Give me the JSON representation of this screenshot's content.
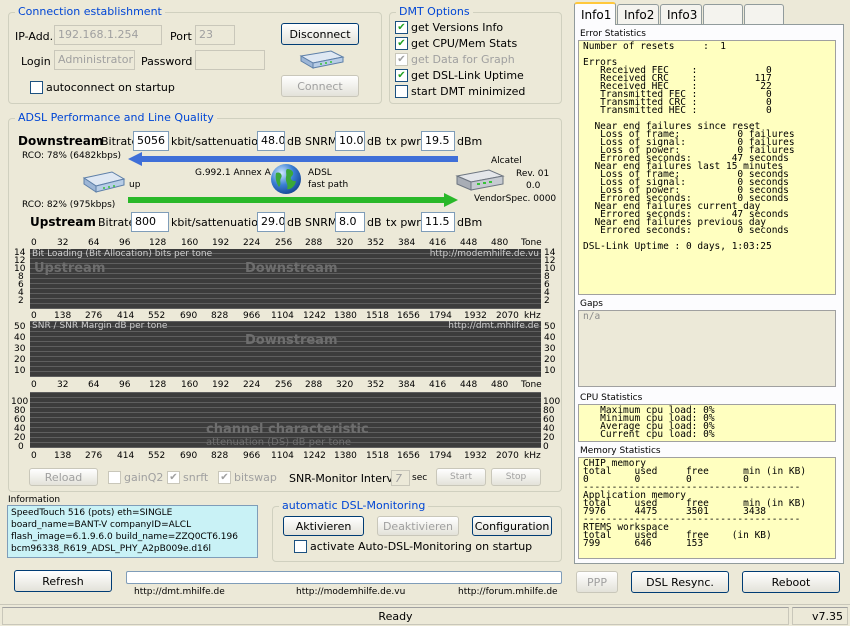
{
  "connection": {
    "title": "Connection establishment",
    "ip_label": "IP-Add.",
    "ip_value": "192.168.1.254",
    "port_label": "Port",
    "port_value": "23",
    "login_label": "Login",
    "login_value": "Administrator",
    "password_label": "Password",
    "password_value": "",
    "autoconnect_label": "autoconnect on startup",
    "disconnect_label": "Disconnect",
    "connect_label": "Connect"
  },
  "dmt_options": {
    "title": "DMT Options",
    "items": [
      {
        "label": "get Versions Info",
        "checked": true,
        "disabled": false
      },
      {
        "label": "get CPU/Mem Stats",
        "checked": true,
        "disabled": false
      },
      {
        "label": "get Data for Graph",
        "checked": true,
        "disabled": true
      },
      {
        "label": "get DSL-Link Uptime",
        "checked": true,
        "disabled": false
      },
      {
        "label": "start DMT minimized",
        "checked": false,
        "disabled": false
      }
    ]
  },
  "adsl": {
    "title": "ADSL Performance and Line Quality",
    "downstream_label": "Downstream",
    "upstream_label": "Upstream",
    "bitrate_label": "Bitrate",
    "kbits": "kbit/s",
    "attn_label": "attenuation",
    "db": "dB",
    "snrm_label": "SNRM",
    "txpwr_label": "tx pwr",
    "dbm": "dBm",
    "down": {
      "bitrate": "5056",
      "attenuation": "48.0",
      "snrm": "10.0",
      "txpwr": "19.5"
    },
    "up": {
      "bitrate": "800",
      "attenuation": "29.0",
      "snrm": "8.0",
      "txpwr": "11.5"
    },
    "rco_down": "RCO: 78% (6482kbps)",
    "rco_up": "RCO: 82% (975kbps)",
    "mode": "G.992.1 Annex A",
    "adsl_label": "ADSL",
    "fastpath": "fast path",
    "up_label": "up",
    "vendor": "Alcatel",
    "rev": "Rev. 01",
    "rev_val": "0.0",
    "vendorspec": "VendorSpec. 0000"
  },
  "graphs": {
    "tone_ticks": [
      "0",
      "32",
      "64",
      "96",
      "128",
      "160",
      "192",
      "224",
      "256",
      "288",
      "320",
      "352",
      "384",
      "416",
      "448",
      "480"
    ],
    "tone_label": "Tone",
    "khz_ticks": [
      "0",
      "138",
      "276",
      "414",
      "552",
      "690",
      "828",
      "966",
      "1104",
      "1242",
      "1380",
      "1518",
      "1656",
      "1794",
      "1932",
      "2070"
    ],
    "khz_label": "kHz",
    "bitload_title": "Bit Loading (Bit Allocation)  bits per tone",
    "bitload_url": "http://modemhilfe.de.vu",
    "bitload_y": [
      "14",
      "12",
      "10",
      "8",
      "6",
      "4",
      "2"
    ],
    "wm_upstream": "Upstream",
    "wm_downstream": "Downstream",
    "snr_title": "SNR / SNR Margin  dB per tone",
    "snr_url": "http://dmt.mhilfe.de",
    "snr_y": [
      "50",
      "40",
      "30",
      "20",
      "10"
    ],
    "wm_downstream2": "Downstream",
    "snr_y3": [
      "100",
      "80",
      "60",
      "40",
      "20",
      "0"
    ],
    "chan_title1": "channel characteristic",
    "chan_title2": "attenuation (DS)  dB per tone"
  },
  "controls": {
    "reload": "Reload",
    "gainq2": "gainQ2",
    "snrft": "snrft",
    "bitswap": "bitswap",
    "snr_monitor": "SNR-Monitor Interval:",
    "interval": "7",
    "sec": "sec",
    "start": "Start",
    "stop": "Stop"
  },
  "information": {
    "title": "Information",
    "lines": [
      "SpeedTouch 516 (pots) eth=SINGLE",
      "board_name=BANT-V  companyID=ALCL",
      "flash_image=6.1.9.6.0  build_name=ZZQ0CT6.196",
      "bcm96338_R619_ADSL_PHY_A2pB009e.d16l"
    ]
  },
  "auto_monitoring": {
    "title": "automatic DSL-Monitoring",
    "activate": "Aktivieren",
    "deactivate": "Deaktivieren",
    "configuration": "Configuration",
    "startup_label": "activate Auto-DSL-Monitoring on startup"
  },
  "bottom": {
    "refresh": "Refresh",
    "links": [
      "http://dmt.mhilfe.de",
      "http://modemhilfe.de.vu",
      "http://forum.mhilfe.de"
    ],
    "ppp": "PPP",
    "resync": "DSL Resync.",
    "reboot": "Reboot"
  },
  "tabs": [
    "Info1",
    "Info2",
    "Info3",
    "",
    ""
  ],
  "error_stats": {
    "title": "Error Statistics",
    "text": "Number of resets     :  1\n\nErrors\n   Received FEC    :            0\n   Received CRC    :          117\n   Received HEC    :           22\n   Transmitted FEC :            0\n   Transmitted CRC :            0\n   Transmitted HEC :            0\n\n  Near end failures since reset\n   Loss of frame:          0 failures\n   Loss of signal:         0 failures\n   Loss of power:          0 failures\n   Errored seconds:       47 seconds\n  Near end failures last 15 minutes\n   Loss of frame:          0 seconds\n   Loss of signal:         0 seconds\n   Loss of power:          0 seconds\n   Errored seconds:        0 seconds\n  Near end failures current day\n   Errored seconds:       47 seconds\n  Near end failures previous day\n   Errored seconds:        0 seconds\n\nDSL-Link Uptime : 0 days, 1:03:25"
  },
  "gaps": {
    "title": "Gaps",
    "text": "n/a"
  },
  "cpu_stats": {
    "title": "CPU Statistics",
    "text": "   Maximum cpu load: 0%\n   Minimum cpu load: 0%\n   Average cpu load: 0%\n   Current cpu load: 0%"
  },
  "mem_stats": {
    "title": "Memory Statistics",
    "text": "CHIP memory\ntotal    used     free      min (in KB)\n0        0        0         0\n--------------------------------------\nApplication memory\ntotal    used     free      min (in KB)\n7976     4475     3501      3438\n--------------------------------------\nRTEMS workspace\ntotal    used     free    (in KB)\n799      646      153"
  },
  "status": {
    "text": "Ready",
    "version": "v7.35"
  },
  "colors": {
    "accent": "#0046d5",
    "downstream_arrow": "#3f6fd8",
    "upstream_arrow": "#29b829",
    "panel": "#ffffc0"
  }
}
